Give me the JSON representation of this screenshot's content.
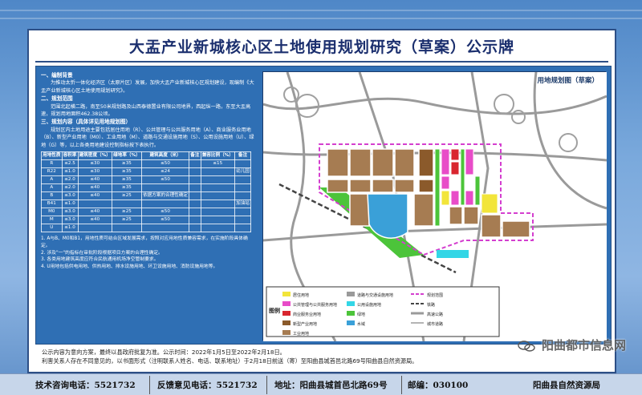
{
  "title": "大盂产业新城核心区土地使用规划研究（草案）公示牌",
  "sections": {
    "background_heading": "一、编制背景",
    "background_text": "为推动太忻一体化经济区（太原片区）发展，加快大盂产业新城核心区规划建设，现编制《大盂产业新城核心区土地使用规划研究》。",
    "scope_heading": "二、规划范围",
    "scope_text": "范围北起横二路，南至50米规划路及山西泰德置业有限公司地界，西起纵一路，东至大盂高速，规划用地面积462.38公顷。",
    "content_heading": "三、规划内容（具体详见用地规划图）",
    "content_text": "规划区内土地用途主要包括居住用地（R）、公共管理与公共服务用地（A）、商业服务业用地（B）、新型产业用地（M0）、工业用地（M）、道路与交通设施用地（S）、公用设施用地（U）、绿地（G）等，以上各类用地建设控制指标按下表执行。"
  },
  "spec_table": {
    "headers": [
      "用地性质",
      "容积率",
      "建筑密度（%）",
      "绿地率（%）",
      "建筑高度（米）",
      "备注",
      "兼容比例（%）",
      "备注"
    ],
    "rows": [
      [
        "R",
        "≤2.5",
        "≤30",
        "≥35",
        "≤50",
        "",
        "≤15",
        ""
      ],
      [
        "R22",
        "≤1.0",
        "≤30",
        "≥35",
        "≤24",
        "",
        "",
        "幼儿园"
      ],
      [
        "A",
        "≤2.0",
        "≤40",
        "≥35",
        "≤50",
        "",
        "",
        ""
      ],
      [
        "A",
        "≤2.0",
        "≤40",
        "≥35",
        "",
        "",
        "",
        ""
      ],
      [
        "B",
        "≤3.0",
        "≤40",
        "≥25",
        "依据方案的合理性确定",
        "",
        "",
        ""
      ],
      [
        "B41",
        "≤1.0",
        "",
        "",
        "",
        "",
        "",
        "加油站"
      ],
      [
        "M0",
        "≤3.0",
        "≤40",
        "≥25",
        "≤50",
        "",
        "",
        ""
      ],
      [
        "M",
        "≤3.0",
        "≤40",
        "≥25",
        "≤50",
        "",
        "",
        ""
      ],
      [
        "U",
        "≤1.0",
        "",
        "",
        "",
        "",
        "",
        ""
      ]
    ]
  },
  "notes": [
    "1. A与B、M0和B1，用地性质可结合区域发展需求，按照对应用地性质兼容需求，在实施阶段具体确定。",
    "2. 涉及\"一\"的指标在审批阶段根据项目方案的合理性确定。",
    "3. 各类用地建筑高度应符合民航通用机场净空管制要求。",
    "4. U用地包括供电用地、供热用地、排水设施用地、环卫设施用地、消防设施用地等。"
  ],
  "map": {
    "label": "用地规划图（草案）",
    "legend_title": "图例",
    "legend_items": [
      "居住用地",
      "公共管理与公共服务用地",
      "商业服务业用地",
      "新型产业用地",
      "工业用地",
      "道路与交通设施用地",
      "公用设施用地",
      "绿地",
      "水域",
      "规划范围",
      "铁路",
      "高速公路",
      "城市道路"
    ],
    "colors": {
      "residential": "#f2e53a",
      "public": "#e84cc8",
      "commercial": "#d9262f",
      "new_industry": "#8b5a2b",
      "industrial": "#a67c52",
      "green": "#4cc43a",
      "water": "#3aa0d8",
      "boundary": "#d43fcf",
      "road": "#8a8a8a"
    }
  },
  "notice": {
    "line1": "公示内容为意向方案，最终以县政府批复为准。公示时间：2022年1月5日至2022年2月18日。",
    "line2": "利害关系人存在不同意见的，以书面形式（注明联系人姓名、电话、联系地址）于2月18日前送（寄）至阳曲县城首邑北路69号阳曲县自然资源局。"
  },
  "contact": {
    "tech_phone": "技术咨询电话：5521732",
    "feedback_phone": "反馈意见电话：5521732",
    "address": "地址：阳曲县城首邑北路69号",
    "postcode": "邮编：030100",
    "org": "阳曲县自然资源局"
  },
  "watermark": "阳曲都市信息网"
}
